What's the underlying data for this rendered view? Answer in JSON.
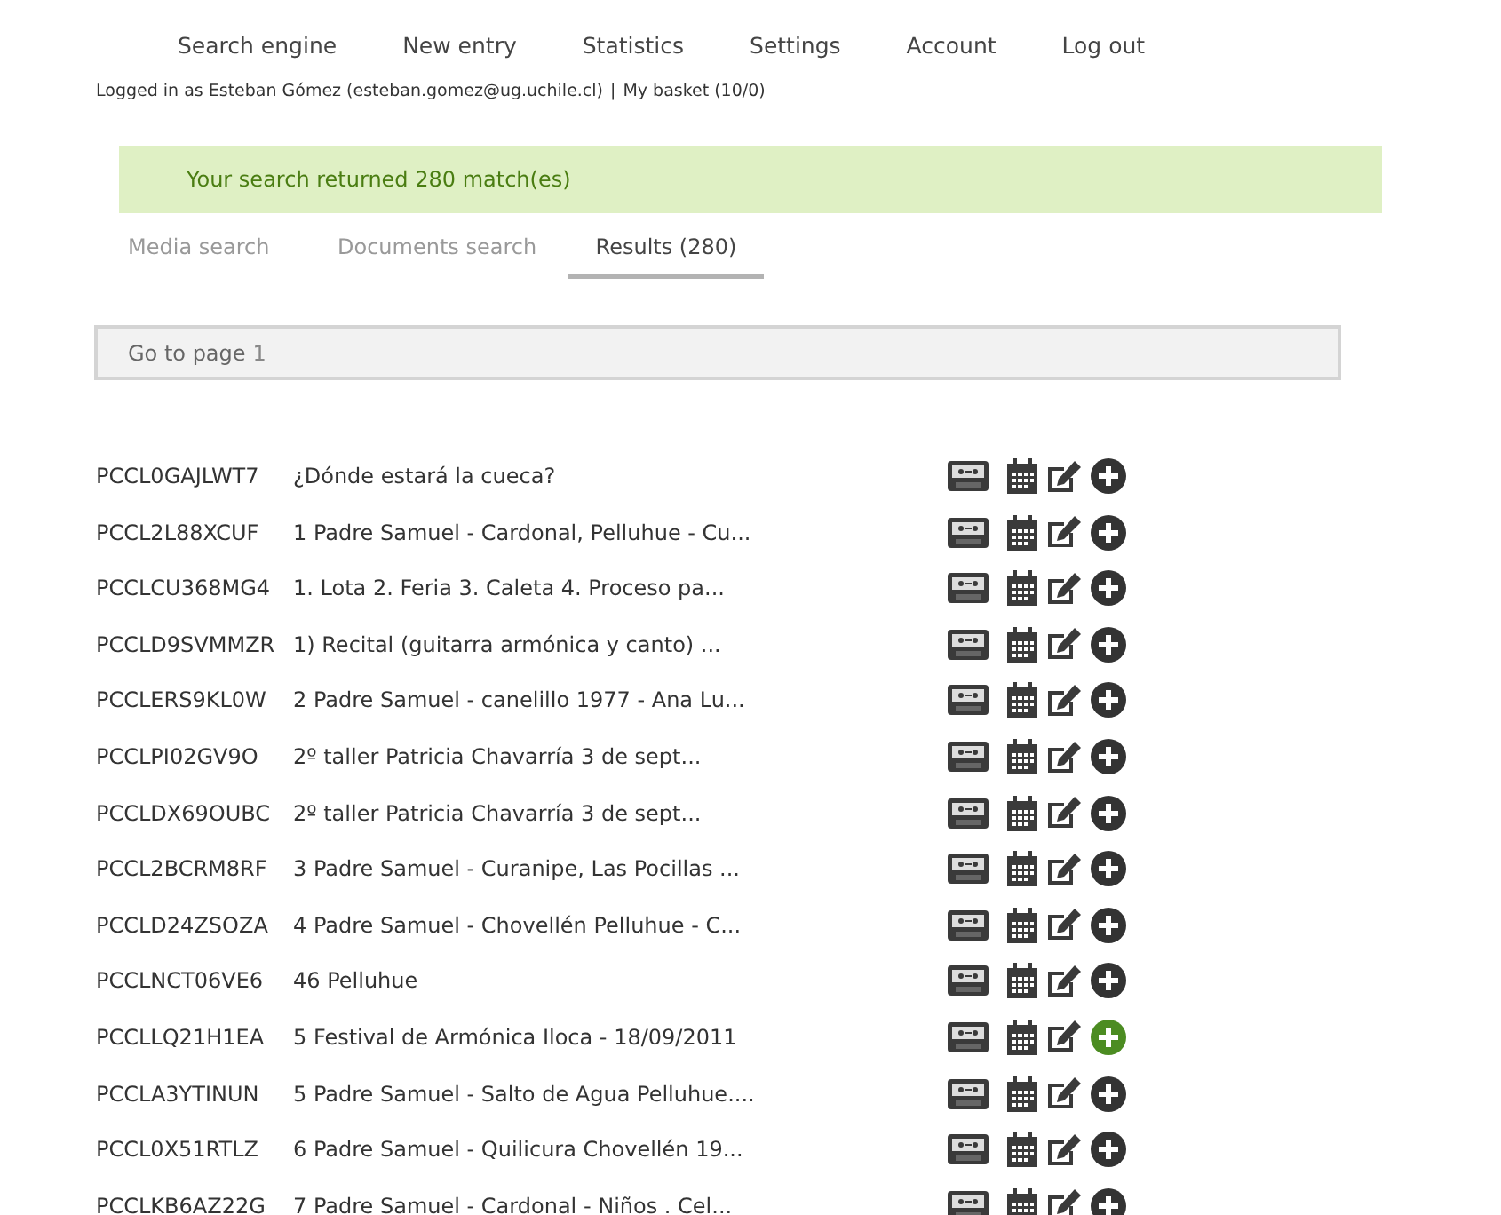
{
  "nav": [
    "Search engine",
    "New entry",
    "Statistics",
    "Settings",
    "Account",
    "Log out"
  ],
  "user_line": {
    "logged_in": "Logged in as Esteban Gómez (esteban.gomez@ug.uchile.cl)",
    "separator": "|",
    "basket": "My basket (10/0)"
  },
  "alert": "Your search returned 280 match(es)",
  "tabs": [
    {
      "label": "Media search",
      "selected": false
    },
    {
      "label": "Documents search",
      "selected": false
    },
    {
      "label": "Results (280)",
      "selected": true
    }
  ],
  "pager": {
    "label": "Go to page",
    "page": "1"
  },
  "results": [
    {
      "id": "PCCL0GAJLWT7",
      "title": "¿Dónde estará la cueca?",
      "highlighted": false
    },
    {
      "id": "PCCL2L88XCUF",
      "title": "1 Padre Samuel - Cardonal, Pelluhue - Cu...",
      "highlighted": false
    },
    {
      "id": "PCCLCU368MG4",
      "title": "1. Lota 2. Feria 3. Caleta 4. Proceso pa...",
      "highlighted": false
    },
    {
      "id": "PCCLD9SVMMZR",
      "title": "1) Recital (guitarra armónica y canto) ...",
      "highlighted": false
    },
    {
      "id": "PCCLERS9KL0W",
      "title": "2 Padre Samuel - canelillo 1977 - Ana Lu...",
      "highlighted": false
    },
    {
      "id": "PCCLPI02GV9O",
      "title": "2º taller Patricia Chavarría 3 de sept...",
      "highlighted": false
    },
    {
      "id": "PCCLDX69OUBC",
      "title": "2º taller Patricia Chavarría 3 de sept...",
      "highlighted": false
    },
    {
      "id": "PCCL2BCRM8RF",
      "title": "3 Padre Samuel - Curanipe, Las Pocillas ...",
      "highlighted": false
    },
    {
      "id": "PCCLD24ZSOZA",
      "title": "4 Padre Samuel - Chovellén Pelluhue - C...",
      "highlighted": false
    },
    {
      "id": "PCCLNCT06VE6",
      "title": "46 Pelluhue",
      "highlighted": false
    },
    {
      "id": "PCCLLQ21H1EA",
      "title": "5 Festival de Armónica Iloca - 18/09/2011",
      "highlighted": true
    },
    {
      "id": "PCCLA3YTINUN",
      "title": "5 Padre Samuel - Salto de Agua Pelluhue....",
      "highlighted": false
    },
    {
      "id": "PCCL0X51RTLZ",
      "title": "6 Padre Samuel - Quilicura Chovellén 19...",
      "highlighted": false
    },
    {
      "id": "PCCLKB6AZ22G",
      "title": "7 Padre Samuel - Cardonal - Niños . Cel...",
      "highlighted": false
    }
  ]
}
